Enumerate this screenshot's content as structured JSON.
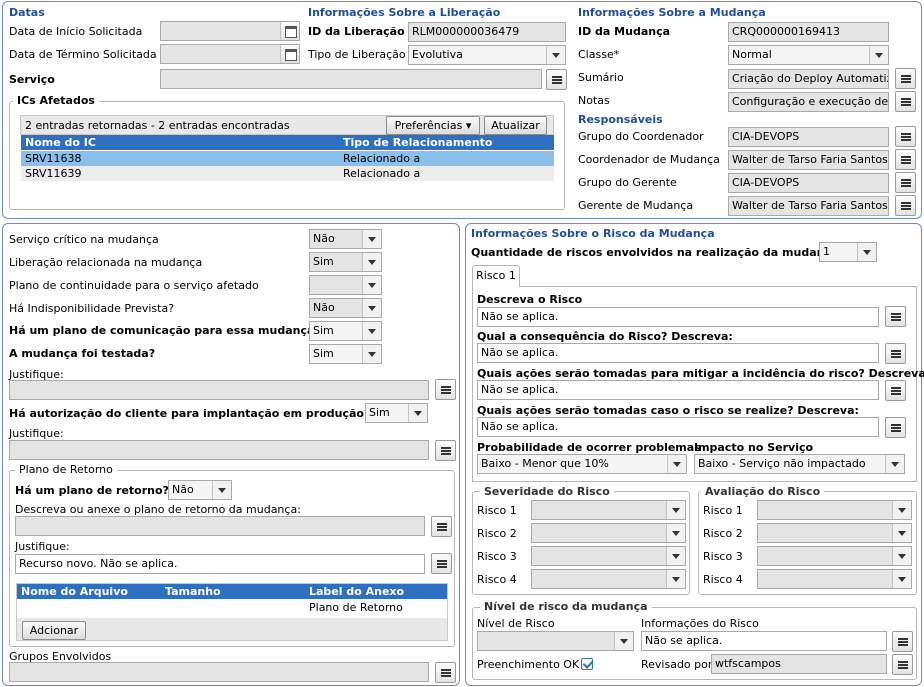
{
  "top": {
    "datas": {
      "title": "Datas",
      "inicio_label": "Data de Início Solicitada",
      "termino_label": "Data de Término Solicitada",
      "inicio_value": "",
      "termino_value": "",
      "servico_label": "Serviço",
      "servico_value": ""
    },
    "liberacao": {
      "title": "Informações Sobre a Liberação",
      "id_label": "ID da Liberação",
      "id_value": "RLM000000036479",
      "tipo_label": "Tipo de Liberação",
      "tipo_value": "Evolutiva"
    },
    "mudanca": {
      "title": "Informações Sobre a Mudança",
      "id_label": "ID da Mudança",
      "id_value": "CRQ000000169413",
      "classe_label": "Classe*",
      "classe_value": "Normal",
      "sumario_label": "Sumário",
      "sumario_value": "Criação do Deploy Automatizado",
      "notas_label": "Notas",
      "notas_value": "Configuração e execução de pipe"
    },
    "responsaveis": {
      "title": "Responsáveis",
      "grupo_coord_label": "Grupo do Coordenador",
      "grupo_coord_value": "CIA-DEVOPS",
      "coord_label": "Coordenador de Mudança",
      "coord_value": "Walter de Tarso Faria Santos de Campos",
      "grupo_ger_label": "Grupo do Gerente",
      "grupo_ger_value": "CIA-DEVOPS",
      "ger_label": "Gerente de Mudança",
      "ger_value": "Walter de Tarso Faria Santos de Campos"
    },
    "ics": {
      "title": "ICs Afetados",
      "summary": "2 entradas retornadas - 2 entradas encontradas",
      "pref_button": "Preferências",
      "update_button": "Atualizar",
      "columns": [
        "Nome do IC",
        "Tipo de Relacionamento"
      ],
      "rows": [
        [
          "SRV11638",
          "Relacionado a"
        ],
        [
          "SRV11639",
          "Relacionado a"
        ]
      ]
    }
  },
  "left": {
    "critico_label": "Serviço crítico na mudança",
    "critico_value": "Não",
    "liberacao_label": "Liberação relacionada na mudança",
    "liberacao_value": "Sim",
    "continuidade_label": "Plano de continuidade para o serviço afetado",
    "continuidade_value": "",
    "indisp_label": "Há Indisponibilidade Prevista?",
    "indisp_value": "Não",
    "comunicacao_label": "Há um plano de comunicação para essa mudança?",
    "comunicacao_value": "Sim",
    "testada_label": "A mudança foi testada?",
    "testada_value": "Sim",
    "justifique1_label": "Justifique:",
    "justifique1_value": "",
    "autorizacao_label": "Há autorização do cliente para implantação em produção?",
    "autorizacao_value": "Sim",
    "justifique2_label": "Justifique:",
    "justifique2_value": "",
    "retorno": {
      "title": "Plano de Retorno",
      "has_label": "Há um plano de retorno?",
      "has_value": "Não",
      "descreva_label": "Descreva ou anexe o plano de retorno da mudança:",
      "descreva_value": "",
      "justifique_label": "Justifique:",
      "justifique_value": "Recurso novo. Não se aplica.",
      "columns": [
        "Nome do Arquivo",
        "Tamanho",
        "Label do Anexo"
      ],
      "rows": [
        [
          "",
          "",
          "Plano de Retorno"
        ]
      ],
      "add_button": "Adcionar"
    },
    "grupos_label": "Grupos Envolvidos",
    "grupos_value": ""
  },
  "right": {
    "title": "Informações Sobre o Risco da Mudança",
    "qtd_label": "Quantidade de riscos envolvidos na realização da mudança",
    "qtd_value": "1",
    "tab_label": "Risco 1",
    "descreva_label": "Descreva o Risco",
    "descreva_value": "Não se aplica.",
    "consequencia_label": "Qual a consequência do Risco? Descreva:",
    "consequencia_value": "Não se aplica.",
    "mitigar_label": "Quais ações serão tomadas para mitigar a incidência do risco? Descreva:",
    "mitigar_value": "Não se aplica.",
    "realize_label": "Quais ações serão tomadas caso o risco se realize? Descreva:",
    "realize_value": "Não se aplica.",
    "prob_label": "Probabilidade de ocorrer problemas",
    "prob_value": "Baixo - Menor que 10%",
    "impacto_label": "Impacto no Serviço",
    "impacto_value": "Baixo - Serviço não impactado",
    "severidade": {
      "title": "Severidade do Risco",
      "labels": [
        "Risco 1",
        "Risco 2",
        "Risco 3",
        "Risco 4"
      ]
    },
    "avaliacao": {
      "title": "Avaliação do Risco",
      "labels": [
        "Risco 1",
        "Risco 2",
        "Risco 3",
        "Risco 4"
      ]
    },
    "nivel": {
      "title": "Nível de risco da mudança",
      "nivel_label": "Nível de Risco",
      "nivel_value": "",
      "info_label": "Informações do Risco",
      "info_value": "Não se aplica.",
      "preench_label": "Preenchimento OK",
      "revisado_label": "Revisado por:",
      "revisado_value": "wtfscampos"
    }
  }
}
